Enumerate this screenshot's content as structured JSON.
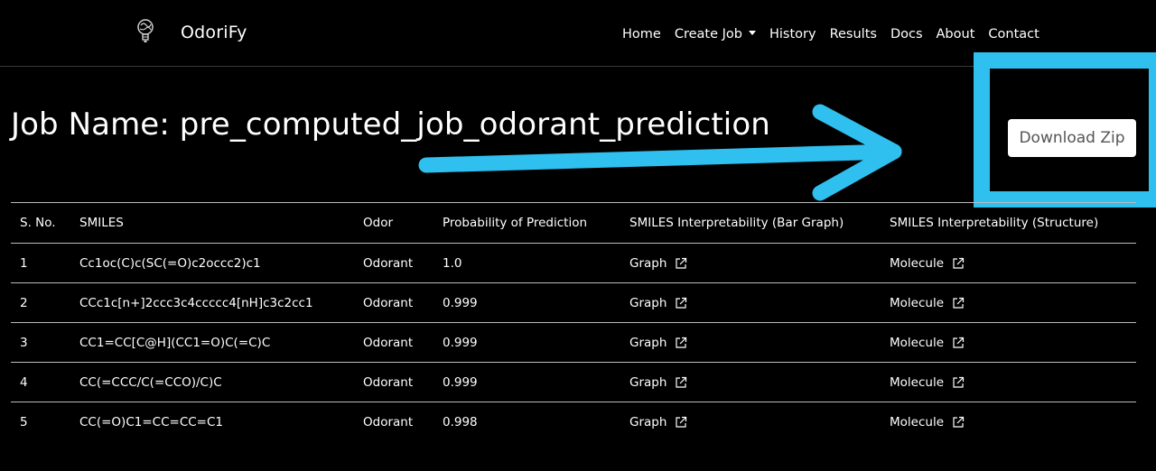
{
  "nav": {
    "brand": "OdoriFy",
    "items": [
      {
        "label": "Home"
      },
      {
        "label": "Create Job"
      },
      {
        "label": "History"
      },
      {
        "label": "Results"
      },
      {
        "label": "Docs"
      },
      {
        "label": "About"
      },
      {
        "label": "Contact"
      }
    ]
  },
  "job": {
    "title": "Job Name: pre_computed_job_odorant_prediction",
    "download_label": "Download Zip"
  },
  "table": {
    "headers": [
      "S. No.",
      "SMILES",
      "Odor",
      "Probability of Prediction",
      "SMILES Interpretability (Bar Graph)",
      "SMILES Interpretability (Structure)"
    ],
    "rows": [
      {
        "sno": "1",
        "smiles": "Cc1oc(C)c(SC(=O)c2occc2)c1",
        "odor": "Odorant",
        "prob": "1.0",
        "graph": "Graph",
        "molecule": "Molecule"
      },
      {
        "sno": "2",
        "smiles": "CCc1c[n+]2ccc3c4ccccc4[nH]c3c2cc1",
        "odor": "Odorant",
        "prob": "0.999",
        "graph": "Graph",
        "molecule": "Molecule"
      },
      {
        "sno": "3",
        "smiles": "CC1=CC[C@H](CC1=O)C(=C)C",
        "odor": "Odorant",
        "prob": "0.999",
        "graph": "Graph",
        "molecule": "Molecule"
      },
      {
        "sno": "4",
        "smiles": "CC(=CCC/C(=CCO)/C)C",
        "odor": "Odorant",
        "prob": "0.999",
        "graph": "Graph",
        "molecule": "Molecule"
      },
      {
        "sno": "5",
        "smiles": "CC(=O)C1=CC=CC=C1",
        "odor": "Odorant",
        "prob": "0.998",
        "graph": "Graph",
        "molecule": "Molecule"
      }
    ]
  },
  "colors": {
    "background": "#000000",
    "highlight": "#2fc0ef",
    "button_bg": "#ffffff"
  }
}
